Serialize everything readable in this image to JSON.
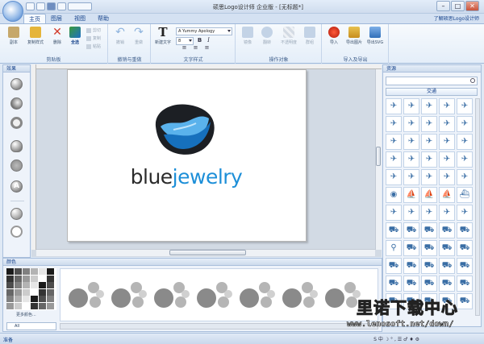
{
  "window": {
    "title": "硕思Logo设计师 企业版 - [无标题*]",
    "help_link": "了解硕思Logo设计师",
    "controls": {
      "minimize": "–",
      "maximize": "□",
      "close": "✕"
    }
  },
  "tabs": [
    {
      "label": "主页",
      "active": true
    },
    {
      "label": "图层",
      "active": false
    },
    {
      "label": "视图",
      "active": false
    },
    {
      "label": "帮助",
      "active": false
    }
  ],
  "ribbon": {
    "clipboard": {
      "label": "剪贴板",
      "paste": "副本",
      "format_painter": "复制样式",
      "delete": "删除",
      "select_all": "全选",
      "cut": "剪切",
      "copy": "复制",
      "paste_small": "粘贴"
    },
    "undo_group": {
      "label": "撤销与重做",
      "undo": "撤销",
      "redo": "重做"
    },
    "text_style": {
      "label": "文字样式",
      "new_text": "新建文字",
      "font": "A Yummy Apology",
      "size": "8",
      "bold": "B",
      "italic": "I",
      "align_left": "≡",
      "align_center": "≡",
      "align_right": "≡"
    },
    "operate": {
      "label": "操作对象",
      "flip": "镜像",
      "rotate": "翻转",
      "transparency": "不透明度",
      "group": "群组"
    },
    "import_export": {
      "label": "导入及导出",
      "import": "导入",
      "export_image": "导出图片",
      "export_svg": "导出SVG"
    }
  },
  "left_panel": {
    "title": "效果"
  },
  "canvas": {
    "logo_text_a": "blue",
    "logo_text_b": "jewelry"
  },
  "resources": {
    "title": "资源",
    "search_placeholder": "",
    "category": "交通"
  },
  "bottom_panel": {
    "title": "颜色",
    "more_colors": "更多颜色...",
    "filter": "All"
  },
  "statusbar": {
    "text": "准备",
    "tray": "S 中 ☽ ° , ☰ ♂ ♦ ⚙"
  },
  "watermark": {
    "title": "里诺下载中心",
    "url": "www.lenosoft.net/down/"
  },
  "colors": {
    "accent": "#1d8fd8",
    "chrome": "#dfe9f5",
    "logo_dark": "#2b2b2b"
  }
}
